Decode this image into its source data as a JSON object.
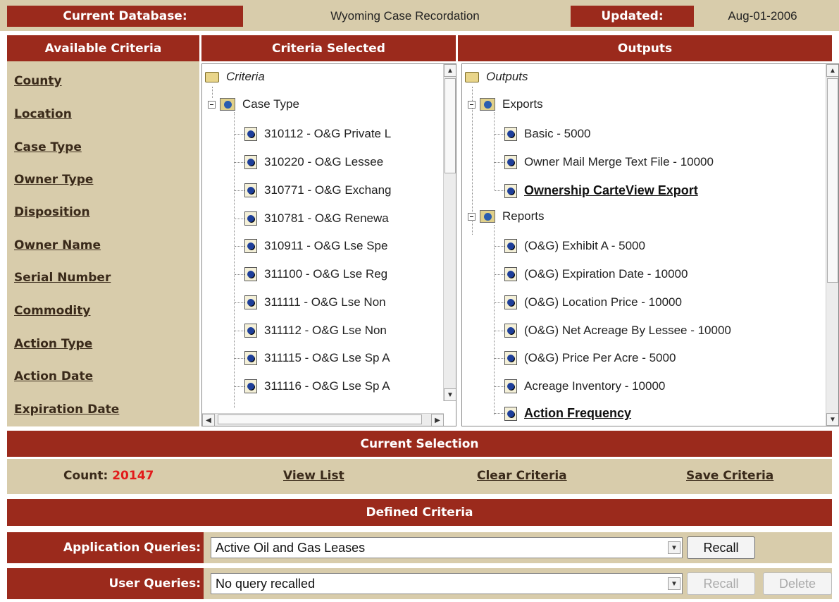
{
  "header": {
    "db_label": "Current Database:",
    "db_value": "Wyoming Case Recordation",
    "updated_label": "Updated:",
    "updated_value": "Aug-01-2006"
  },
  "sections": {
    "available": "Available Criteria",
    "selected": "Criteria Selected",
    "outputs": "Outputs"
  },
  "available_criteria": [
    "County",
    "Location",
    "Case Type",
    "Owner Type",
    "Disposition",
    "Owner Name",
    "Serial Number",
    "Commodity",
    "Action Type",
    "Action Date",
    "Expiration Date"
  ],
  "criteria_tree": {
    "root": "Criteria",
    "group": "Case Type",
    "items": [
      "310112 - O&G Private L",
      "310220 - O&G Lessee",
      "310771 - O&G Exchang",
      "310781 - O&G Renewa",
      "310911 - O&G Lse Spe",
      "311100 - O&G Lse Reg",
      "311111 - O&G Lse Non",
      "311112 - O&G Lse Non",
      "311115 - O&G Lse Sp A",
      "311116 - O&G Lse Sp A"
    ]
  },
  "outputs_tree": {
    "root": "Outputs",
    "exports_label": "Exports",
    "exports": [
      "Basic - 5000",
      "Owner Mail Merge Text File - 10000",
      "Ownership CarteView Export"
    ],
    "reports_label": "Reports",
    "reports": [
      "(O&G) Exhibit A - 5000",
      "(O&G) Expiration Date - 10000",
      "(O&G) Location Price - 10000",
      "(O&G) Net Acreage By Lessee - 10000",
      "(O&G) Price Per Acre - 5000",
      "Acreage Inventory - 10000",
      "Action Frequency"
    ]
  },
  "current_selection": {
    "title": "Current Selection",
    "count_label": "Count:",
    "count_value": "20147",
    "view_list": "View List",
    "clear_criteria": "Clear Criteria",
    "save_criteria": "Save Criteria"
  },
  "defined_criteria": {
    "title": "Defined Criteria",
    "app_label": "Application Queries:",
    "app_value": "Active Oil and Gas Leases",
    "user_label": "User Queries:",
    "user_value": "No query recalled",
    "recall": "Recall",
    "delete": "Delete"
  },
  "colors": {
    "bar": "#9b2a1c",
    "tan": "#d8ccab",
    "count": "#e21b1b"
  }
}
